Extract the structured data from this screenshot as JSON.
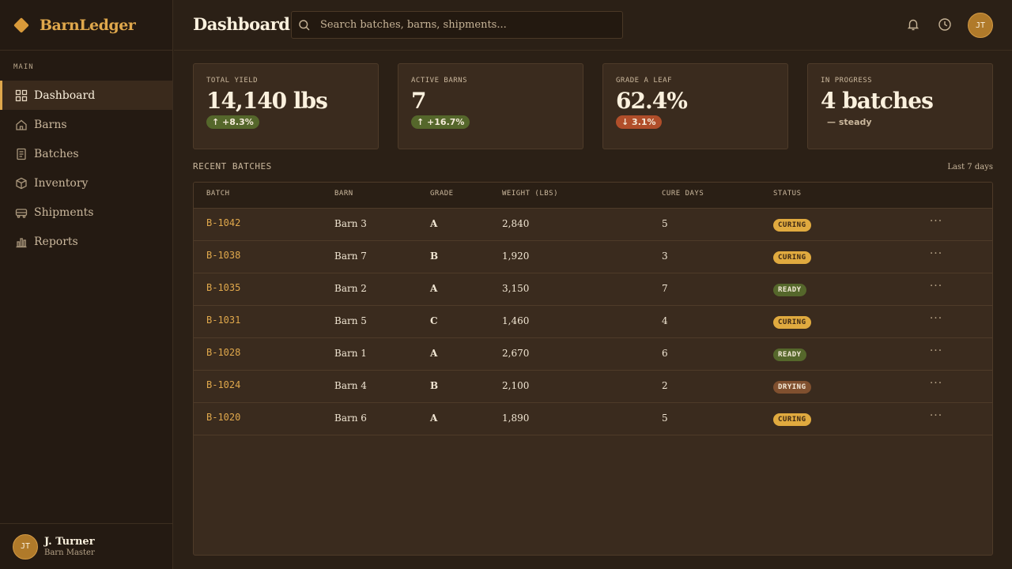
{
  "app": {
    "name": "BarnLedger"
  },
  "sidebar": {
    "section_label": "MAIN",
    "items": [
      {
        "label": "Dashboard",
        "icon": "grid-icon",
        "active": true
      },
      {
        "label": "Barns",
        "icon": "home-icon",
        "active": false
      },
      {
        "label": "Batches",
        "icon": "document-icon",
        "active": false
      },
      {
        "label": "Inventory",
        "icon": "box-icon",
        "active": false
      },
      {
        "label": "Shipments",
        "icon": "truck-icon",
        "active": false
      },
      {
        "label": "Reports",
        "icon": "bar-chart-icon",
        "active": false
      }
    ],
    "user": {
      "initials": "JT",
      "name": "J. Turner",
      "role": "Barn Master"
    }
  },
  "header": {
    "title": "Dashboard",
    "search_placeholder": "Search batches, barns, shipments...",
    "avatar_initials": "JT"
  },
  "stats": [
    {
      "label": "TOTAL YIELD",
      "value": "14,140 lbs",
      "delta": "↑ +8.3%",
      "trend": "up"
    },
    {
      "label": "ACTIVE BARNS",
      "value": "7",
      "delta": "↑ +16.7%",
      "trend": "up"
    },
    {
      "label": "GRADE A LEAF",
      "value": "62.4%",
      "delta": "↓ 3.1%",
      "trend": "down"
    },
    {
      "label": "IN PROGRESS",
      "value": "4 batches",
      "delta": "— steady",
      "trend": "flat"
    }
  ],
  "recent": {
    "title": "RECENT BATCHES",
    "range": "Last 7 days",
    "columns": [
      "BATCH",
      "BARN",
      "GRADE",
      "WEIGHT (LBS)",
      "CURE DAYS",
      "STATUS"
    ],
    "rows": [
      {
        "batch": "B-1042",
        "barn": "Barn 3",
        "grade": "A",
        "weight": "2,840",
        "days": "5",
        "status": "CURING"
      },
      {
        "batch": "B-1038",
        "barn": "Barn 7",
        "grade": "B",
        "weight": "1,920",
        "days": "3",
        "status": "CURING"
      },
      {
        "batch": "B-1035",
        "barn": "Barn 2",
        "grade": "A",
        "weight": "3,150",
        "days": "7",
        "status": "READY"
      },
      {
        "batch": "B-1031",
        "barn": "Barn 5",
        "grade": "C",
        "weight": "1,460",
        "days": "4",
        "status": "CURING"
      },
      {
        "batch": "B-1028",
        "barn": "Barn 1",
        "grade": "A",
        "weight": "2,670",
        "days": "6",
        "status": "READY"
      },
      {
        "batch": "B-1024",
        "barn": "Barn 4",
        "grade": "B",
        "weight": "2,100",
        "days": "2",
        "status": "DRYING"
      },
      {
        "batch": "B-1020",
        "barn": "Barn 6",
        "grade": "A",
        "weight": "1,890",
        "days": "5",
        "status": "CURING"
      }
    ]
  },
  "colors": {
    "accent": "#e0a84c",
    "background": "#2b2016",
    "card": "#3a2b1e",
    "status_curing": "#e0aa3f",
    "status_ready": "#55672b",
    "status_drying": "#80502f",
    "trend_down": "#b04e2a"
  }
}
